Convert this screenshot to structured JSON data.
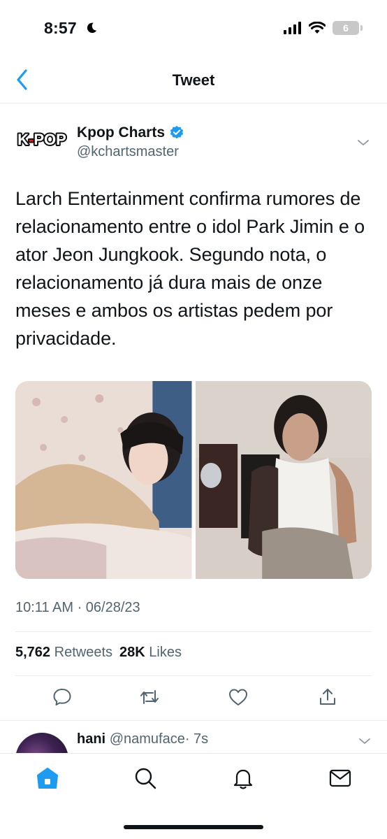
{
  "status_bar": {
    "time": "8:57",
    "battery": "6"
  },
  "nav": {
    "title": "Tweet"
  },
  "tweet": {
    "logo_text": "K-POP",
    "author_name": "Kpop Charts",
    "author_handle": "@kchartsmaster",
    "text": "Larch Entertainment confirma rumores de relacionamento entre o idol Park Jimin e o ator Jeon Jungkook. Segundo nota, o relacionamento já dura mais de onze meses e ambos os artistas pedem por privacidade.",
    "timestamp": "10:11 AM · 06/28/23",
    "retweets_count": "5,762",
    "retweets_label": "Retweets",
    "likes_count": "28K",
    "likes_label": "Likes"
  },
  "reply": {
    "name": "hani",
    "handle": "@namuface",
    "time": "· 7s"
  },
  "colors": {
    "accent": "#1d9bf0",
    "secondary_text": "#536471",
    "logo_red": "#e0201b"
  },
  "icons": {
    "back": "chevron-left-icon",
    "verified": "verified-badge-icon",
    "more": "chevron-down-icon",
    "reply": "comment-icon",
    "retweet": "retweet-icon",
    "like": "heart-icon",
    "share": "share-icon",
    "home": "home-icon",
    "search": "search-icon",
    "notifications": "bell-icon",
    "messages": "mail-icon"
  }
}
